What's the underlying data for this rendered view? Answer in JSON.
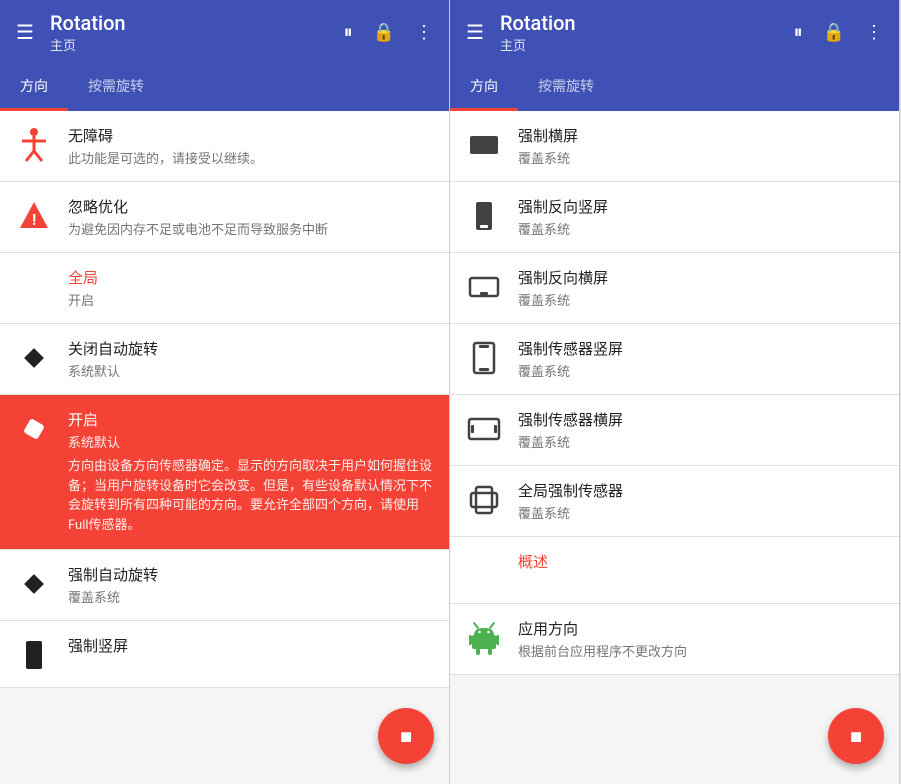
{
  "app": {
    "name": "Rotation",
    "subtitle": "主页"
  },
  "tabs": [
    {
      "id": "direction",
      "label": "方向",
      "active": true
    },
    {
      "id": "auto",
      "label": "按需旋转",
      "active": false
    }
  ],
  "header_actions": {
    "pause_label": "⏸",
    "lock_label": "🔒",
    "more_label": "⋮"
  },
  "panel_left": {
    "items": [
      {
        "id": "accessibility",
        "icon": "accessibility",
        "title": "无障碍",
        "subtitle": "此功能是可选的，请接受以继续。",
        "selected": false
      },
      {
        "id": "ignore-optimization",
        "icon": "warning",
        "title": "忽略优化",
        "subtitle": "为避免因内存不足或电池不足而导致服务中断",
        "selected": false
      },
      {
        "id": "global",
        "icon": "none",
        "title": "全局",
        "title_red": true,
        "subtitle": "开启",
        "selected": false
      },
      {
        "id": "disable-auto",
        "icon": "diamond",
        "title": "关闭自动旋转",
        "subtitle": "系统默认",
        "selected": false
      },
      {
        "id": "enable",
        "icon": "eraser",
        "title": "开启",
        "subtitle": "系统默认",
        "desc": "方向由设备方向传感器确定。显示的方向取决于用户如何握住设备；当用户旋转设备时它会改变。但是，有些设备默认情况下不会旋转到所有四种可能的方向。要允许全部四个方向，请使用Full传感器。",
        "selected": true
      },
      {
        "id": "force-auto",
        "icon": "diamond",
        "title": "强制自动旋转",
        "subtitle": "覆盖系统",
        "selected": false
      },
      {
        "id": "force-portrait",
        "icon": "portrait",
        "title": "强制竖屏",
        "subtitle": "",
        "selected": false
      }
    ]
  },
  "panel_right": {
    "items": [
      {
        "id": "force-landscape",
        "icon": "landscape-filled",
        "title": "强制横屏",
        "subtitle": "覆盖系统"
      },
      {
        "id": "force-reverse-portrait",
        "icon": "portrait-filled",
        "title": "强制反向竖屏",
        "subtitle": "覆盖系统"
      },
      {
        "id": "force-reverse-landscape",
        "icon": "landscape-bottom",
        "title": "强制反向横屏",
        "subtitle": "覆盖系统"
      },
      {
        "id": "force-sensor-portrait",
        "icon": "portrait-sensor",
        "title": "强制传感器竖屏",
        "subtitle": "覆盖系统"
      },
      {
        "id": "force-sensor-landscape",
        "icon": "landscape-sensor",
        "title": "强制传感器横屏",
        "subtitle": "覆盖系统"
      },
      {
        "id": "full-force-sensor",
        "icon": "full-sensor",
        "title": "全局强制传感器",
        "subtitle": "覆盖系统"
      },
      {
        "id": "overview",
        "icon": "none",
        "title": "概述",
        "title_red": true,
        "subtitle": ""
      },
      {
        "id": "app-direction",
        "icon": "android",
        "title": "应用方向",
        "subtitle": "根据前台应用程序不更改方向"
      }
    ]
  },
  "fab": {
    "icon": "■"
  }
}
